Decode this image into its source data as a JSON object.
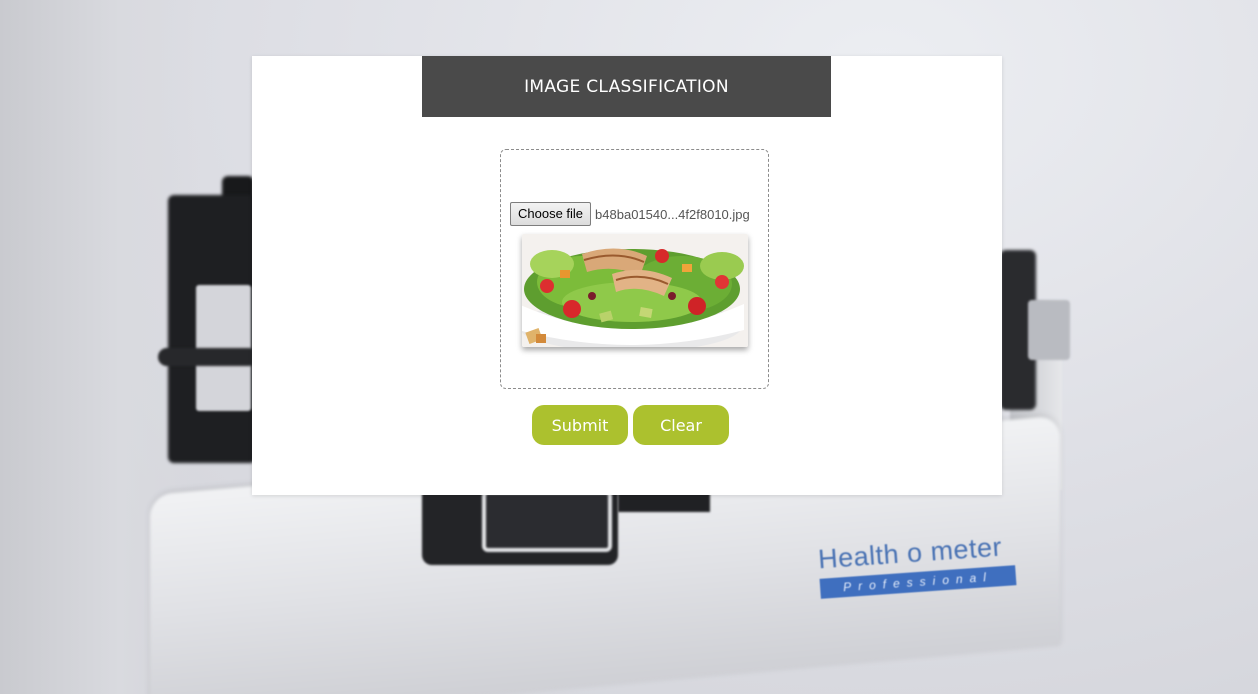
{
  "page": {
    "title": "IMAGE CLASSIFICATION"
  },
  "upload": {
    "choose_file_label": "Choose file",
    "file_name": "b48ba01540...4f2f8010.jpg"
  },
  "actions": {
    "submit_label": "Submit",
    "clear_label": "Clear"
  },
  "background": {
    "brand_name": "Health o meter",
    "brand_sub": "Professional"
  },
  "colors": {
    "header_bg": "#4a4a4a",
    "button_bg": "#acc12e",
    "brand_blue": "#3f6fbf"
  }
}
